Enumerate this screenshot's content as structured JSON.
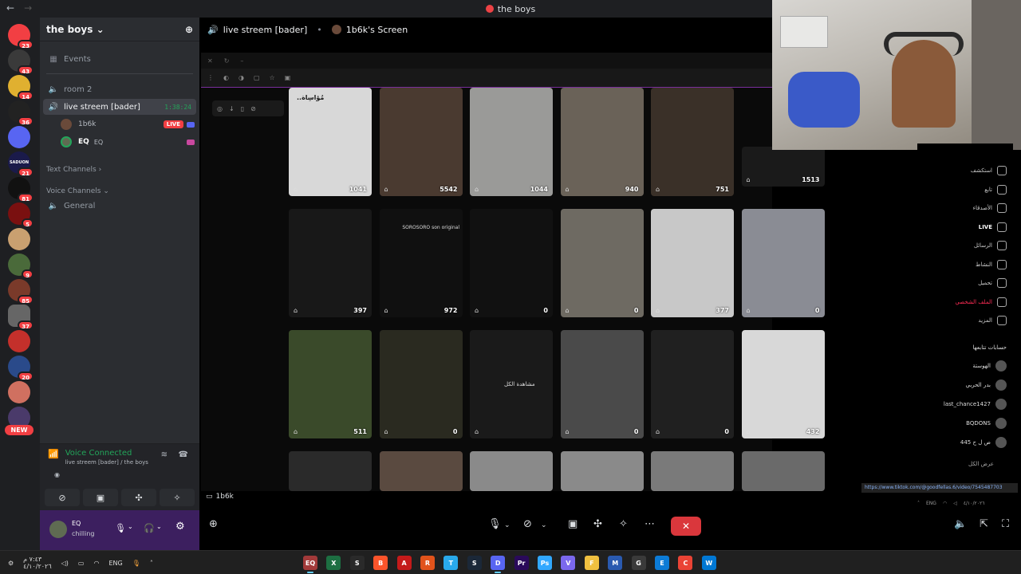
{
  "titlebar": {
    "title": "the boys"
  },
  "rail": {
    "servers": [
      {
        "label": "",
        "color": "#f23f43",
        "badge": "23"
      },
      {
        "label": "",
        "color": "#3a3a3a",
        "badge": "43"
      },
      {
        "label": "",
        "color": "#e0b030",
        "badge": "14"
      },
      {
        "label": "",
        "color": "#222",
        "badge": "36"
      },
      {
        "label": "",
        "color": "#5865f2",
        "badge": ""
      },
      {
        "label": "SADUON",
        "color": "#1a1a4a",
        "badge": "21"
      },
      {
        "label": "",
        "color": "#111",
        "badge": "81"
      },
      {
        "label": "",
        "color": "#7a1010",
        "badge": "5"
      },
      {
        "label": "",
        "color": "#c9a070",
        "badge": ""
      },
      {
        "label": "",
        "color": "#4a6a3a",
        "badge": "9"
      },
      {
        "label": "",
        "color": "#7a3a2a",
        "badge": "85"
      },
      {
        "label": "",
        "color": "#666",
        "badge": "37"
      },
      {
        "label": "",
        "color": "#c4302b",
        "badge": ""
      },
      {
        "label": "",
        "color": "#2a4a8a",
        "badge": "20"
      },
      {
        "label": "",
        "color": "#d07060",
        "badge": ""
      },
      {
        "label": "",
        "color": "#4a3a6a",
        "badge": ""
      }
    ],
    "new_label": "NEW"
  },
  "sidebar": {
    "guild_name": "the boys",
    "room2": "room 2",
    "live_channel": "live streem [bader]",
    "live_time": "1:38:24",
    "members": [
      {
        "name": "1b6k",
        "live": "LIVE"
      },
      {
        "name": "EQ",
        "tag": "EQ"
      }
    ],
    "events": "Events",
    "text_channels": "Text Channels",
    "voice_channels": "Voice Channels",
    "general": "General"
  },
  "voice_panel": {
    "status": "Voice Connected",
    "location": "live streem [bader] / the boys"
  },
  "user_panel": {
    "username": "EQ",
    "status": "chilling"
  },
  "stream_header": {
    "channel": "live streem [bader]",
    "screen": "1b6k's Screen"
  },
  "stream": {
    "name_tag": "1b6k",
    "tiles": [
      {
        "views": "1041",
        "color": "#d8d8d8"
      },
      {
        "views": "5542",
        "color": "#4a3a30"
      },
      {
        "views": "1044",
        "color": "#9a9a98"
      },
      {
        "views": "940",
        "color": "#6a6258"
      },
      {
        "views": "751",
        "color": "#3a3028"
      },
      {
        "views": "1513",
        "color": "#1a1a1a"
      },
      {
        "views": "397",
        "color": "#181818"
      },
      {
        "views": "972",
        "color": "#101010"
      },
      {
        "views": "0",
        "color": "#111"
      },
      {
        "views": "0",
        "color": "#6e6a62"
      },
      {
        "views": "377",
        "color": "#c8c8c8"
      },
      {
        "views": "0",
        "color": "#8a8c94"
      },
      {
        "views": "511",
        "color": "#3a4a2a"
      },
      {
        "views": "0",
        "color": "#2a2a20"
      },
      {
        "views": "",
        "color": "#1a1a1a"
      },
      {
        "views": "0",
        "color": "#4a4a4a"
      },
      {
        "views": "0",
        "color": "#202020"
      },
      {
        "views": "432",
        "color": "#d8d8d8"
      },
      {
        "views": "",
        "color": "#2a2a2a"
      },
      {
        "views": "",
        "color": "#5a4a40"
      },
      {
        "views": "",
        "color": "#8a8a8a"
      },
      {
        "views": "",
        "color": "#8a8a8a"
      },
      {
        "views": "",
        "color": "#7a7a7a"
      },
      {
        "views": "",
        "color": "#6a6a6a"
      }
    ],
    "center_text": "مشاهدة الكل",
    "tile_text_1": "مُؤاسِاة..",
    "tile_text_2": "SOROSORO son original"
  },
  "tiktok_nav": {
    "items": [
      "استكشف",
      "تابع",
      "الأصدقاء",
      "LIVE",
      "الرسائل",
      "النشاط",
      "تحميل",
      "الملف الشخصي",
      "المزيد"
    ],
    "following_title": "حسابات تتابعها",
    "accounts": [
      "الهوستة",
      "بدر الحربي",
      "last_chance1427",
      "BQDONS",
      "445 ص ل ح"
    ],
    "see_all": "عرض الكل"
  },
  "url_tip": "https://www.tiktok.com/@goodfellas.6/video/7545487703",
  "taskbar": {
    "tray_time": "٧:٤٣ م",
    "tray_date": "٤/١٠/٢٠٢٦",
    "lang": "ENG",
    "apps": [
      "EQ",
      "X",
      "S",
      "B",
      "A",
      "R",
      "T",
      "S",
      "D",
      "Pr",
      "Ps",
      "V",
      "F",
      "M",
      "G",
      "E",
      "C",
      "W"
    ]
  },
  "colors": {
    "accent": "#5865f2",
    "live": "#f23f43",
    "green": "#23a55a",
    "endcall": "#da373c"
  }
}
